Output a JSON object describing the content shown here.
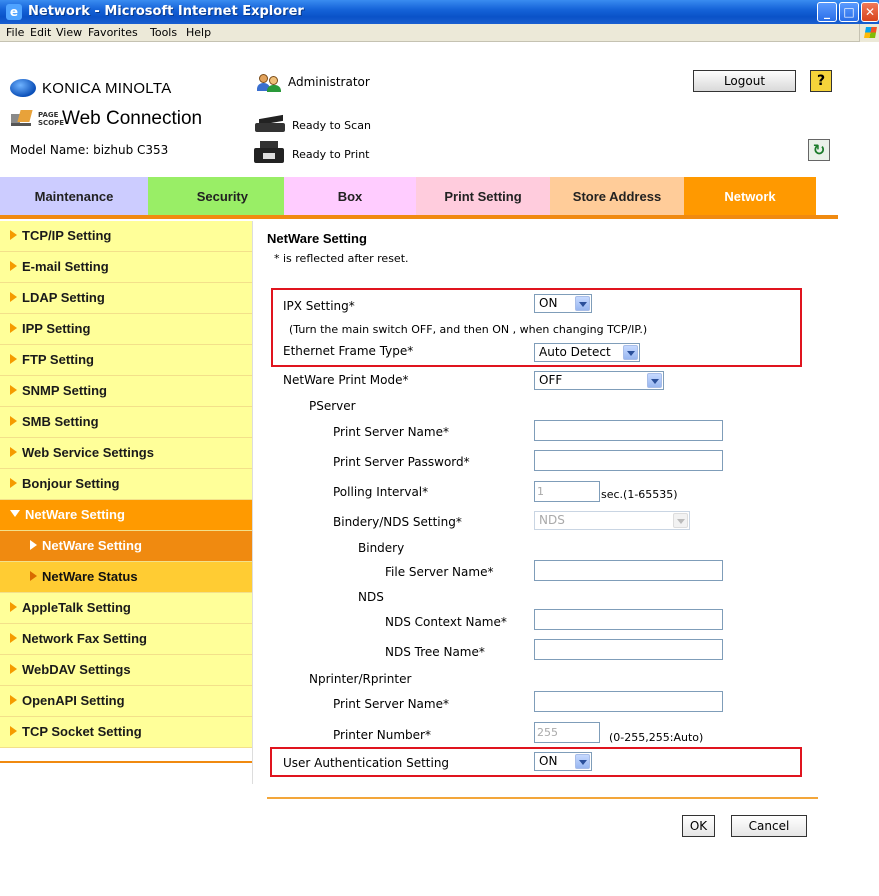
{
  "window": {
    "title": "Network - Microsoft Internet Explorer"
  },
  "menu": [
    "File",
    "Edit",
    "View",
    "Favorites",
    "Tools",
    "Help"
  ],
  "header": {
    "brand": "KONICA MINOLTA",
    "page_scope_label": "PAGE SCOPE",
    "product": "Web Connection",
    "model": "Model Name: bizhub C353",
    "user": "Administrator",
    "logout_label": "Logout",
    "help_label": "?",
    "scan_status": "Ready to Scan",
    "print_status": "Ready to Print",
    "refresh_label": "↻"
  },
  "tabs": [
    {
      "label": "Maintenance",
      "color": "#ccccff"
    },
    {
      "label": "Security",
      "color": "#99ee66"
    },
    {
      "label": "Box",
      "color": "#ffccff"
    },
    {
      "label": "Print Setting",
      "color": "#ffccdd"
    },
    {
      "label": "Store Address",
      "color": "#ffcc99"
    },
    {
      "label": "Network",
      "color": "#ff9900",
      "active": true
    }
  ],
  "sidebar": {
    "items": [
      {
        "label": "TCP/IP Setting"
      },
      {
        "label": "E-mail Setting"
      },
      {
        "label": "LDAP Setting"
      },
      {
        "label": "IPP Setting"
      },
      {
        "label": "FTP Setting"
      },
      {
        "label": "SNMP Setting"
      },
      {
        "label": "SMB Setting"
      },
      {
        "label": "Web Service Settings"
      },
      {
        "label": "Bonjour Setting"
      },
      {
        "label": "NetWare Setting",
        "state": "active"
      },
      {
        "label": "NetWare Setting",
        "state": "sub-selected"
      },
      {
        "label": "NetWare Status",
        "state": "sub"
      },
      {
        "label": "AppleTalk Setting"
      },
      {
        "label": "Network Fax Setting"
      },
      {
        "label": "WebDAV Settings"
      },
      {
        "label": "OpenAPI Setting"
      },
      {
        "label": "TCP Socket Setting"
      }
    ]
  },
  "main": {
    "heading": "NetWare Setting",
    "note": "* is reflected after reset.",
    "ipx_label": "IPX Setting*",
    "ipx_value": "ON",
    "ipx_note": "(Turn the main switch OFF, and then ON , when changing TCP/IP.)",
    "frame_label": "Ethernet Frame Type*",
    "frame_value": "Auto Detect",
    "print_mode_label": "NetWare Print Mode*",
    "print_mode_value": "OFF",
    "pserver_label": "PServer",
    "ps_name_label": "Print Server Name*",
    "ps_name_value": "",
    "ps_password_label": "Print Server Password*",
    "ps_password_value": "",
    "polling_label": "Polling Interval*",
    "polling_value": "1",
    "polling_unit": "sec.(1-65535)",
    "bindery_nds_label": "Bindery/NDS Setting*",
    "bindery_nds_value": "NDS",
    "bindery_label": "Bindery",
    "file_server_label": "File Server Name*",
    "file_server_value": "",
    "nds_label": "NDS",
    "nds_context_label": "NDS Context Name*",
    "nds_context_value": "",
    "nds_tree_label": "NDS Tree Name*",
    "nds_tree_value": "",
    "nprinter_label": "Nprinter/Rprinter",
    "np_server_label": "Print Server Name*",
    "np_server_value": "",
    "printer_number_label": "Printer Number*",
    "printer_number_value": "255",
    "printer_number_range": "(0-255,255:Auto)",
    "user_auth_label": "User Authentication Setting",
    "user_auth_value": "ON",
    "ok_label": "OK",
    "cancel_label": "Cancel"
  },
  "colors": {
    "accent": "#ff9900",
    "sidebar_bg": "#ffff99",
    "highlight_box": "#e0141e"
  }
}
